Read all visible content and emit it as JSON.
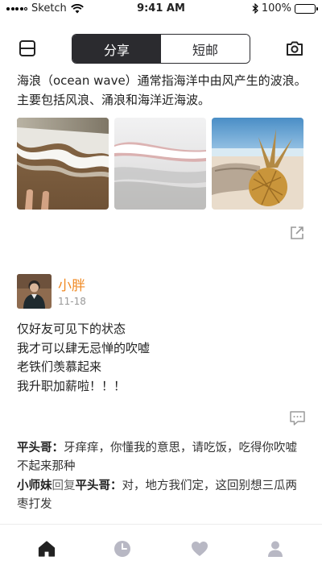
{
  "status_bar": {
    "carrier": "Sketch",
    "time": "9:41 AM",
    "battery": "100%"
  },
  "nav": {
    "left_icon": "scan-icon",
    "right_icon": "camera-icon",
    "tabs": [
      {
        "label": "分享",
        "active": true
      },
      {
        "label": "短邮",
        "active": false
      }
    ]
  },
  "post": {
    "text": "海浪（ocean wave）通常指海洋中由风产生的波浪。主要包括风浪、涌浪和海洋近海波。",
    "photos": [
      "beach-foam-photo",
      "wave-shore-photo",
      "pineapple-beach-photo"
    ],
    "share_icon": "share-icon"
  },
  "moment": {
    "author": "小胖",
    "date": "11-18",
    "lines": [
      "仅好友可见下的状态",
      "我才可以肆无忌惮的吹嘘",
      "老铁们羡慕起来",
      "我升职加薪啦！！！"
    ],
    "comment_icon": "comment-icon"
  },
  "comments": [
    {
      "name": "平头哥：",
      "text": "牙痒痒，你懂我的意思，请吃饭，吃得你吹嘘不起来那种"
    },
    {
      "name": "小师妹",
      "verb": "回复",
      "target": "平头哥：",
      "text": "对，地方我们定，这回别想三瓜两枣打发"
    }
  ],
  "tabbar": {
    "items": [
      "home-icon",
      "clock-icon",
      "heart-icon",
      "user-icon"
    ]
  }
}
